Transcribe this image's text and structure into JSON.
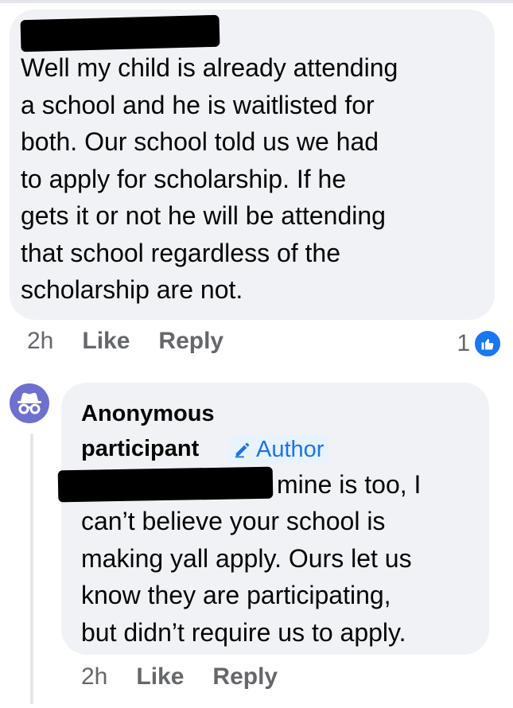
{
  "comment": {
    "text": "Well my child is already attending\na school and he is waitlisted for\nboth. Our school told us we had\nto apply for scholarship. If he\ngets it or not he will be attending\nthat school regardless of the\nscholarship are not.",
    "time": "2h",
    "like_label": "Like",
    "reply_label": "Reply",
    "reaction_count": "1",
    "reaction_icon": "thumbs-up-icon",
    "reaction_color": "#1877f2"
  },
  "reply": {
    "author_line1": "Anonymous",
    "author_line2": "participant",
    "author_badge": "Author",
    "badge_icon": "pencil-icon",
    "avatar_icon": "incognito-icon",
    "avatar_color": "#6f6fd0",
    "text_first_line": "mine is too, I",
    "text_rest": "can’t believe your school is\nmaking yall apply. Ours let us\nknow they are participating,\nbut didn’t require us to apply.",
    "time": "2h",
    "like_label": "Like",
    "reply_label": "Reply"
  }
}
